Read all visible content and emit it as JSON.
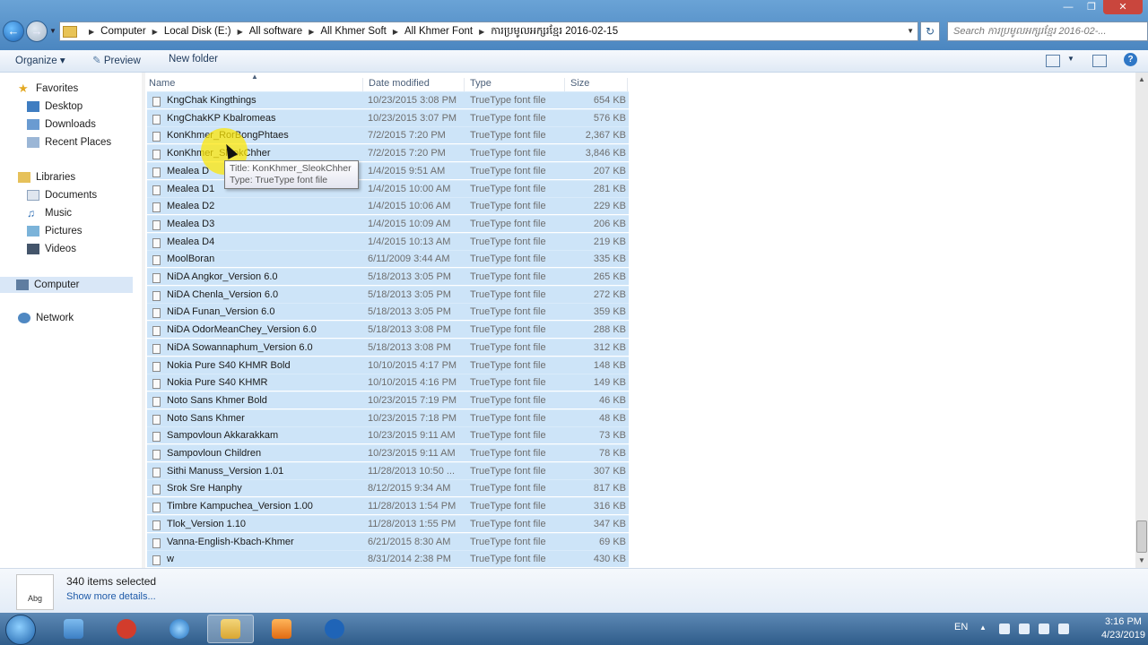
{
  "window": {
    "controls": [
      "—",
      "❐",
      "✕"
    ]
  },
  "address": {
    "crumbs": [
      "Computer",
      "Local Disk (E:)",
      "All software",
      "All Khmer Soft",
      "All Khmer Font",
      "ការប្រមូលអក្សរខ្មែរ 2016-02-15"
    ],
    "search_placeholder": "Search ការប្រមូលអក្សរខ្មែរ 2016-02-..."
  },
  "toolbar": {
    "organize": "Organize ▾",
    "preview": "Preview",
    "new_folder": "New folder"
  },
  "navpane": {
    "favorites": "Favorites",
    "desktop": "Desktop",
    "downloads": "Downloads",
    "recent": "Recent Places",
    "libraries": "Libraries",
    "documents": "Documents",
    "music": "Music",
    "pictures": "Pictures",
    "videos": "Videos",
    "computer": "Computer",
    "network": "Network"
  },
  "columns": {
    "name": "Name",
    "date": "Date modified",
    "type": "Type",
    "size": "Size"
  },
  "files": [
    {
      "name": "KngChak Kingthings",
      "date": "10/23/2015 3:08 PM",
      "type": "TrueType font file",
      "size": "654 KB"
    },
    {
      "name": "KngChakKP Kbalromeas",
      "date": "10/23/2015 3:07 PM",
      "type": "TrueType font file",
      "size": "576 KB"
    },
    {
      "name": "KonKhmer_RorBongPhtaes",
      "date": "7/2/2015 7:20 PM",
      "type": "TrueType font file",
      "size": "2,367 KB"
    },
    {
      "name": "KonKhmer_SleokChher",
      "date": "7/2/2015 7:20 PM",
      "type": "TrueType font file",
      "size": "3,846 KB"
    },
    {
      "name": "Mealea D",
      "date": "1/4/2015 9:51 AM",
      "type": "TrueType font file",
      "size": "207 KB"
    },
    {
      "name": "Mealea D1",
      "date": "1/4/2015 10:00 AM",
      "type": "TrueType font file",
      "size": "281 KB"
    },
    {
      "name": "Mealea D2",
      "date": "1/4/2015 10:06 AM",
      "type": "TrueType font file",
      "size": "229 KB"
    },
    {
      "name": "Mealea D3",
      "date": "1/4/2015 10:09 AM",
      "type": "TrueType font file",
      "size": "206 KB"
    },
    {
      "name": "Mealea D4",
      "date": "1/4/2015 10:13 AM",
      "type": "TrueType font file",
      "size": "219 KB"
    },
    {
      "name": "MoolBoran",
      "date": "6/11/2009 3:44 AM",
      "type": "TrueType font file",
      "size": "335 KB"
    },
    {
      "name": "NiDA Angkor_Version 6.0",
      "date": "5/18/2013 3:05 PM",
      "type": "TrueType font file",
      "size": "265 KB"
    },
    {
      "name": "NiDA Chenla_Version 6.0",
      "date": "5/18/2013 3:05 PM",
      "type": "TrueType font file",
      "size": "272 KB"
    },
    {
      "name": "NiDA Funan_Version 6.0",
      "date": "5/18/2013 3:05 PM",
      "type": "TrueType font file",
      "size": "359 KB"
    },
    {
      "name": "NiDA OdorMeanChey_Version 6.0",
      "date": "5/18/2013 3:08 PM",
      "type": "TrueType font file",
      "size": "288 KB"
    },
    {
      "name": "NiDA Sowannaphum_Version 6.0",
      "date": "5/18/2013 3:08 PM",
      "type": "TrueType font file",
      "size": "312 KB"
    },
    {
      "name": "Nokia Pure S40 KHMR Bold",
      "date": "10/10/2015 4:17 PM",
      "type": "TrueType font file",
      "size": "148 KB"
    },
    {
      "name": "Nokia Pure S40 KHMR",
      "date": "10/10/2015 4:16 PM",
      "type": "TrueType font file",
      "size": "149 KB"
    },
    {
      "name": "Noto Sans Khmer Bold",
      "date": "10/23/2015 7:19 PM",
      "type": "TrueType font file",
      "size": "46 KB"
    },
    {
      "name": "Noto Sans Khmer",
      "date": "10/23/2015 7:18 PM",
      "type": "TrueType font file",
      "size": "48 KB"
    },
    {
      "name": "Sampovloun Akkarakkam",
      "date": "10/23/2015 9:11 AM",
      "type": "TrueType font file",
      "size": "73 KB"
    },
    {
      "name": "Sampovloun Children",
      "date": "10/23/2015 9:11 AM",
      "type": "TrueType font file",
      "size": "78 KB"
    },
    {
      "name": "Sithi Manuss_Version 1.01",
      "date": "11/28/2013 10:50 ...",
      "type": "TrueType font file",
      "size": "307 KB"
    },
    {
      "name": "Srok Sre Hanphy",
      "date": "8/12/2015 9:34 AM",
      "type": "TrueType font file",
      "size": "817 KB"
    },
    {
      "name": "Timbre Kampuchea_Version 1.00",
      "date": "11/28/2013 1:54 PM",
      "type": "TrueType font file",
      "size": "316 KB"
    },
    {
      "name": "Tlok_Version 1.10",
      "date": "11/28/2013 1:55 PM",
      "type": "TrueType font file",
      "size": "347 KB"
    },
    {
      "name": "Vanna-English-Kbach-Khmer",
      "date": "6/21/2015 8:30 AM",
      "type": "TrueType font file",
      "size": "69 KB"
    },
    {
      "name": "w",
      "date": "8/31/2014 2:38 PM",
      "type": "TrueType font file",
      "size": "430 KB"
    }
  ],
  "tooltip": {
    "title": "Title: KonKhmer_SleokChher",
    "type": "Type: TrueType font file"
  },
  "details": {
    "icon_text": "Abg",
    "count": "340 items selected",
    "more": "Show more details..."
  },
  "taskbar": {
    "lang": "EN",
    "time": "3:16 PM",
    "date": "4/23/2019"
  }
}
